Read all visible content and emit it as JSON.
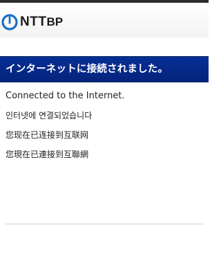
{
  "brand": {
    "logo_text_prefix": "NTT",
    "logo_text_suffix": "BP",
    "logo_color": "#1a6fc9"
  },
  "title_bar": {
    "text": "インターネットに接続されました。",
    "background": "#1b4a86"
  },
  "messages": {
    "english": "Connected to the Internet.",
    "korean": "인터넷에 연결되었습니다",
    "chinese_simplified": "您现在已连接到互联网",
    "chinese_traditional": "您現在已連接到互聯網"
  }
}
